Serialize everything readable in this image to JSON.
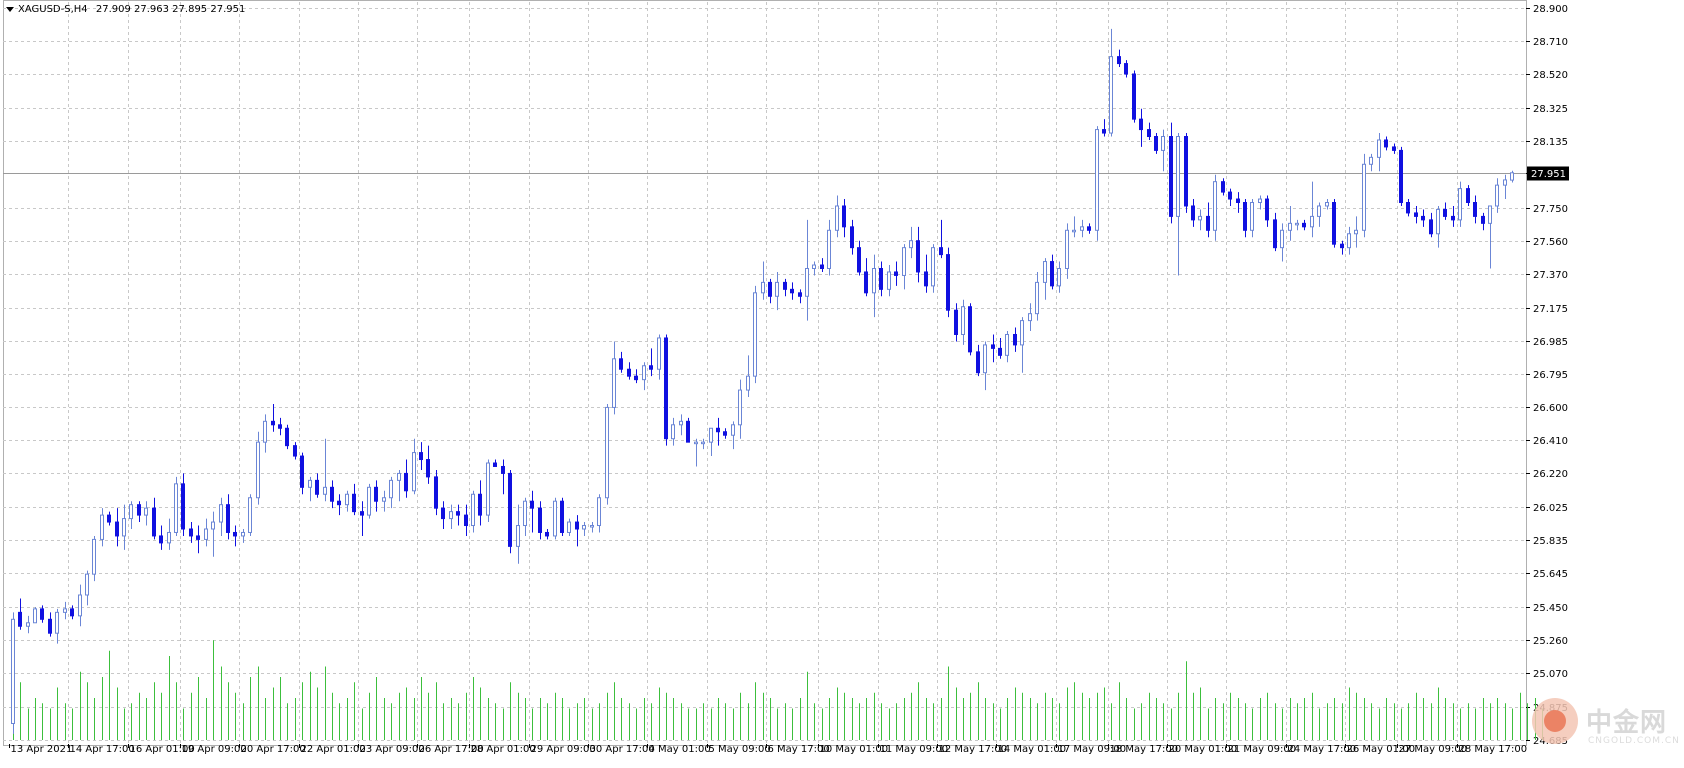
{
  "header": {
    "symbol": "XAGUSD-S,H4",
    "ohlc": "27.909 27.963 27.895 27.951"
  },
  "price_scale": [
    "28.900",
    "28.710",
    "28.520",
    "28.325",
    "28.135",
    "27.951",
    "27.750",
    "27.560",
    "27.370",
    "27.175",
    "26.985",
    "26.795",
    "26.600",
    "26.410",
    "26.220",
    "26.025",
    "25.835",
    "25.645",
    "25.450",
    "25.260",
    "25.070",
    "24.875",
    "24.685"
  ],
  "current_price": "27.951",
  "time_labels": [
    "13 Apr 2021",
    "14 Apr 17:00",
    "16 Apr 01:00",
    "19 Apr 09:00",
    "20 Apr 17:00",
    "22 Apr 01:00",
    "23 Apr 09:00",
    "26 Apr 17:00",
    "28 Apr 01:00",
    "29 Apr 09:00",
    "30 Apr 17:00",
    "4 May 01:00",
    "5 May 09:00",
    "6 May 17:00",
    "10 May 01:00",
    "11 May 09:00",
    "12 May 17:00",
    "14 May 01:00",
    "17 May 09:00",
    "18 May 17:00",
    "20 May 01:00",
    "21 May 09:00",
    "24 May 17:00",
    "26 May 01:00",
    "27 May 09:00",
    "28 May 17:00"
  ],
  "watermark": {
    "title": "中金网",
    "subtitle": "CNGOLD.COM.CN"
  },
  "colors": {
    "bull_body": "#ffffff",
    "bull_outline": "#6b86d6",
    "bear_body": "#1010e0",
    "volume": "#3cbf3c",
    "grid": "#c8c8c8",
    "current_line": "#9a9a9a",
    "price_tag_bg": "#000000",
    "price_tag_text": "#ffffff"
  },
  "chart_data": {
    "type": "candlestick",
    "symbol": "XAGUSD-S",
    "timeframe": "H4",
    "ylim": [
      24.685,
      28.9
    ],
    "grid": true,
    "current_price": 27.951,
    "ohlc": [
      [
        24.78,
        25.42,
        24.72,
        25.38
      ],
      [
        25.42,
        25.5,
        25.32,
        25.34
      ],
      [
        25.34,
        25.4,
        25.3,
        25.36
      ],
      [
        25.36,
        25.45,
        25.36,
        25.44
      ],
      [
        25.44,
        25.46,
        25.36,
        25.38
      ],
      [
        25.38,
        25.42,
        25.28,
        25.3
      ],
      [
        25.3,
        25.44,
        25.24,
        25.42
      ],
      [
        25.42,
        25.48,
        25.38,
        25.44
      ],
      [
        25.44,
        25.46,
        25.38,
        25.4
      ],
      [
        25.4,
        25.58,
        25.34,
        25.52
      ],
      [
        25.52,
        25.66,
        25.46,
        25.64
      ],
      [
        25.64,
        25.86,
        25.6,
        25.84
      ],
      [
        25.84,
        26.02,
        25.8,
        25.98
      ],
      [
        25.98,
        26.0,
        25.92,
        25.94
      ],
      [
        25.94,
        26.02,
        25.8,
        25.86
      ],
      [
        25.86,
        26.04,
        25.78,
        25.96
      ],
      [
        25.96,
        26.06,
        25.9,
        26.04
      ],
      [
        26.04,
        26.06,
        25.94,
        25.98
      ],
      [
        25.98,
        26.06,
        25.92,
        26.02
      ],
      [
        26.02,
        26.08,
        25.84,
        25.86
      ],
      [
        25.86,
        25.92,
        25.78,
        25.82
      ],
      [
        25.82,
        25.96,
        25.78,
        25.88
      ],
      [
        25.88,
        26.2,
        25.86,
        26.16
      ],
      [
        26.16,
        26.22,
        25.86,
        25.9
      ],
      [
        25.9,
        25.94,
        25.82,
        25.86
      ],
      [
        25.86,
        25.92,
        25.76,
        25.84
      ],
      [
        25.84,
        25.96,
        25.8,
        25.9
      ],
      [
        25.9,
        26.0,
        25.74,
        25.94
      ],
      [
        25.94,
        26.08,
        25.86,
        26.04
      ],
      [
        26.04,
        26.1,
        25.84,
        25.88
      ],
      [
        25.88,
        25.92,
        25.8,
        25.86
      ],
      [
        25.86,
        25.9,
        25.82,
        25.88
      ],
      [
        25.88,
        26.1,
        25.86,
        26.08
      ],
      [
        26.08,
        26.46,
        26.04,
        26.4
      ],
      [
        26.4,
        26.56,
        26.34,
        26.52
      ],
      [
        26.52,
        26.62,
        26.46,
        26.5
      ],
      [
        26.5,
        26.54,
        26.44,
        26.48
      ],
      [
        26.48,
        26.5,
        26.36,
        26.38
      ],
      [
        26.38,
        26.4,
        26.3,
        26.32
      ],
      [
        26.32,
        26.34,
        26.1,
        26.14
      ],
      [
        26.14,
        26.2,
        26.06,
        26.18
      ],
      [
        26.18,
        26.22,
        26.08,
        26.1
      ],
      [
        26.1,
        26.42,
        26.06,
        26.14
      ],
      [
        26.14,
        26.18,
        26.02,
        26.06
      ],
      [
        26.06,
        26.1,
        25.98,
        26.04
      ],
      [
        26.04,
        26.12,
        26.0,
        26.1
      ],
      [
        26.1,
        26.16,
        25.98,
        26.0
      ],
      [
        26.0,
        26.06,
        25.86,
        25.98
      ],
      [
        25.98,
        26.16,
        25.96,
        26.14
      ],
      [
        26.14,
        26.18,
        26.0,
        26.06
      ],
      [
        26.06,
        26.12,
        26.0,
        26.08
      ],
      [
        26.08,
        26.2,
        26.02,
        26.18
      ],
      [
        26.18,
        26.24,
        26.06,
        26.22
      ],
      [
        26.22,
        26.3,
        26.08,
        26.12
      ],
      [
        26.12,
        26.42,
        26.1,
        26.34
      ],
      [
        26.34,
        26.4,
        26.24,
        26.3
      ],
      [
        26.3,
        26.38,
        26.16,
        26.2
      ],
      [
        26.2,
        26.24,
        25.98,
        26.02
      ],
      [
        26.02,
        26.06,
        25.9,
        25.96
      ],
      [
        25.96,
        26.04,
        25.9,
        26.0
      ],
      [
        26.0,
        26.04,
        25.92,
        25.98
      ],
      [
        25.98,
        26.04,
        25.86,
        25.92
      ],
      [
        25.92,
        26.12,
        25.88,
        26.1
      ],
      [
        26.1,
        26.18,
        25.92,
        25.98
      ],
      [
        25.98,
        26.3,
        25.94,
        26.28
      ],
      [
        26.28,
        26.3,
        26.26,
        26.26
      ],
      [
        26.26,
        26.3,
        26.1,
        26.22
      ],
      [
        26.22,
        26.24,
        25.76,
        25.8
      ],
      [
        25.8,
        26.04,
        25.7,
        25.92
      ],
      [
        25.92,
        26.08,
        25.86,
        26.06
      ],
      [
        26.06,
        26.12,
        25.88,
        26.02
      ],
      [
        26.02,
        26.06,
        25.84,
        25.88
      ],
      [
        25.88,
        25.9,
        25.84,
        25.86
      ],
      [
        25.86,
        26.08,
        25.84,
        26.06
      ],
      [
        26.06,
        26.08,
        25.86,
        25.88
      ],
      [
        25.88,
        25.96,
        25.86,
        25.94
      ],
      [
        25.94,
        25.98,
        25.8,
        25.9
      ],
      [
        25.9,
        25.94,
        25.86,
        25.92
      ],
      [
        25.92,
        25.94,
        25.88,
        25.92
      ],
      [
        25.92,
        26.1,
        25.88,
        26.08
      ],
      [
        26.08,
        26.62,
        26.04,
        26.6
      ],
      [
        26.6,
        26.98,
        26.56,
        26.88
      ],
      [
        26.88,
        26.92,
        26.8,
        26.82
      ],
      [
        26.82,
        26.86,
        26.76,
        26.78
      ],
      [
        26.78,
        26.82,
        26.74,
        26.76
      ],
      [
        26.76,
        26.86,
        26.7,
        26.84
      ],
      [
        26.84,
        26.94,
        26.78,
        26.82
      ],
      [
        26.82,
        27.02,
        26.76,
        27.0
      ],
      [
        27.0,
        27.02,
        26.38,
        26.42
      ],
      [
        26.42,
        26.54,
        26.38,
        26.5
      ],
      [
        26.5,
        26.56,
        26.44,
        26.52
      ],
      [
        26.52,
        26.54,
        26.42,
        26.4
      ],
      [
        26.4,
        26.42,
        26.26,
        26.4
      ],
      [
        26.4,
        26.42,
        26.36,
        26.4
      ],
      [
        26.4,
        26.44,
        26.32,
        26.48
      ],
      [
        26.48,
        26.54,
        26.38,
        26.46
      ],
      [
        26.46,
        26.48,
        26.42,
        26.44
      ],
      [
        26.44,
        26.52,
        26.36,
        26.5
      ],
      [
        26.5,
        26.76,
        26.42,
        26.7
      ],
      [
        26.7,
        26.9,
        26.66,
        26.78
      ],
      [
        26.78,
        27.3,
        26.74,
        27.26
      ],
      [
        27.26,
        27.44,
        27.22,
        27.32
      ],
      [
        27.32,
        27.34,
        27.2,
        27.24
      ],
      [
        27.24,
        27.38,
        27.16,
        27.32
      ],
      [
        27.32,
        27.34,
        27.24,
        27.28
      ],
      [
        27.28,
        27.32,
        27.22,
        27.26
      ],
      [
        27.26,
        27.28,
        27.2,
        27.24
      ],
      [
        27.24,
        27.68,
        27.1,
        27.4
      ],
      [
        27.4,
        27.44,
        27.36,
        27.42
      ],
      [
        27.42,
        27.46,
        27.38,
        27.4
      ],
      [
        27.4,
        27.68,
        27.36,
        27.62
      ],
      [
        27.62,
        27.82,
        27.58,
        27.76
      ],
      [
        27.76,
        27.8,
        27.58,
        27.64
      ],
      [
        27.64,
        27.68,
        27.48,
        27.52
      ],
      [
        27.52,
        27.56,
        27.36,
        27.38
      ],
      [
        27.38,
        27.46,
        27.24,
        27.26
      ],
      [
        27.26,
        27.48,
        27.12,
        27.4
      ],
      [
        27.4,
        27.44,
        27.24,
        27.28
      ],
      [
        27.28,
        27.42,
        27.24,
        27.38
      ],
      [
        27.38,
        27.44,
        27.3,
        27.36
      ],
      [
        27.36,
        27.54,
        27.28,
        27.52
      ],
      [
        27.52,
        27.64,
        27.46,
        27.56
      ],
      [
        27.56,
        27.64,
        27.32,
        27.38
      ],
      [
        27.38,
        27.48,
        27.26,
        27.3
      ],
      [
        27.3,
        27.54,
        27.26,
        27.52
      ],
      [
        27.52,
        27.68,
        27.46,
        27.48
      ],
      [
        27.48,
        27.52,
        27.12,
        27.16
      ],
      [
        27.16,
        27.2,
        26.98,
        27.02
      ],
      [
        27.02,
        27.22,
        26.96,
        27.18
      ],
      [
        27.18,
        27.2,
        26.9,
        26.92
      ],
      [
        26.92,
        26.96,
        26.78,
        26.8
      ],
      [
        26.8,
        26.98,
        26.7,
        26.96
      ],
      [
        26.96,
        27.02,
        26.86,
        26.94
      ],
      [
        26.94,
        27.0,
        26.88,
        26.9
      ],
      [
        26.9,
        27.04,
        26.86,
        27.02
      ],
      [
        27.02,
        27.06,
        26.92,
        26.96
      ],
      [
        26.96,
        27.12,
        26.8,
        27.1
      ],
      [
        27.1,
        27.2,
        27.04,
        27.14
      ],
      [
        27.14,
        27.38,
        27.1,
        27.32
      ],
      [
        27.32,
        27.46,
        27.22,
        27.44
      ],
      [
        27.44,
        27.48,
        27.28,
        27.3
      ],
      [
        27.3,
        27.44,
        27.26,
        27.4
      ],
      [
        27.4,
        27.66,
        27.34,
        27.62
      ],
      [
        27.62,
        27.7,
        27.58,
        27.62
      ],
      [
        27.62,
        27.68,
        27.58,
        27.64
      ],
      [
        27.64,
        27.66,
        27.6,
        27.62
      ],
      [
        27.62,
        28.22,
        27.56,
        28.2
      ],
      [
        28.2,
        28.26,
        28.16,
        28.18
      ],
      [
        28.18,
        28.78,
        28.16,
        28.62
      ],
      [
        28.62,
        28.66,
        28.56,
        28.58
      ],
      [
        28.58,
        28.6,
        28.5,
        28.52
      ],
      [
        28.52,
        28.54,
        28.24,
        28.26
      ],
      [
        28.26,
        28.32,
        28.1,
        28.2
      ],
      [
        28.2,
        28.24,
        28.14,
        28.16
      ],
      [
        28.16,
        28.18,
        28.06,
        28.08
      ],
      [
        28.08,
        28.2,
        27.96,
        28.16
      ],
      [
        28.16,
        28.24,
        27.66,
        27.7
      ],
      [
        27.7,
        28.18,
        27.36,
        28.16
      ],
      [
        28.16,
        28.18,
        27.72,
        27.76
      ],
      [
        27.76,
        27.8,
        27.64,
        27.68
      ],
      [
        27.68,
        27.74,
        27.62,
        27.7
      ],
      [
        27.7,
        27.78,
        27.58,
        27.62
      ],
      [
        27.62,
        27.94,
        27.56,
        27.9
      ],
      [
        27.9,
        27.92,
        27.82,
        27.84
      ],
      [
        27.84,
        27.86,
        27.76,
        27.8
      ],
      [
        27.8,
        27.84,
        27.72,
        27.78
      ],
      [
        27.78,
        27.8,
        27.58,
        27.62
      ],
      [
        27.62,
        27.8,
        27.58,
        27.78
      ],
      [
        27.78,
        27.82,
        27.74,
        27.8
      ],
      [
        27.8,
        27.82,
        27.64,
        27.68
      ],
      [
        27.68,
        27.72,
        27.5,
        27.52
      ],
      [
        27.52,
        27.66,
        27.44,
        27.62
      ],
      [
        27.62,
        27.76,
        27.56,
        27.66
      ],
      [
        27.66,
        27.68,
        27.62,
        27.66
      ],
      [
        27.66,
        27.68,
        27.62,
        27.64
      ],
      [
        27.64,
        27.9,
        27.58,
        27.7
      ],
      [
        27.7,
        27.78,
        27.64,
        27.76
      ],
      [
        27.76,
        27.8,
        27.74,
        27.78
      ],
      [
        27.78,
        27.8,
        27.52,
        27.54
      ],
      [
        27.54,
        27.56,
        27.48,
        27.52
      ],
      [
        27.52,
        27.64,
        27.48,
        27.6
      ],
      [
        27.6,
        27.7,
        27.52,
        27.62
      ],
      [
        27.62,
        28.06,
        27.58,
        28.0
      ],
      [
        28.0,
        28.06,
        27.96,
        28.04
      ],
      [
        28.04,
        28.18,
        27.96,
        28.14
      ],
      [
        28.14,
        28.16,
        28.08,
        28.1
      ],
      [
        28.1,
        28.12,
        28.06,
        28.08
      ],
      [
        28.08,
        28.1,
        27.76,
        27.78
      ],
      [
        27.78,
        27.8,
        27.7,
        27.72
      ],
      [
        27.72,
        27.76,
        27.66,
        27.7
      ],
      [
        27.7,
        27.74,
        27.64,
        27.68
      ],
      [
        27.68,
        27.72,
        27.58,
        27.6
      ],
      [
        27.6,
        27.76,
        27.52,
        27.74
      ],
      [
        27.74,
        27.78,
        27.68,
        27.7
      ],
      [
        27.7,
        27.76,
        27.64,
        27.68
      ],
      [
        27.68,
        27.9,
        27.64,
        27.86
      ],
      [
        27.86,
        27.88,
        27.76,
        27.78
      ],
      [
        27.78,
        27.82,
        27.66,
        27.7
      ],
      [
        27.7,
        27.72,
        27.62,
        27.66
      ],
      [
        27.66,
        27.74,
        27.4,
        27.76
      ],
      [
        27.76,
        27.92,
        27.72,
        27.88
      ],
      [
        27.88,
        27.94,
        27.8,
        27.91
      ],
      [
        27.909,
        27.963,
        27.895,
        27.951
      ]
    ],
    "volume": [
      0.45,
      0.55,
      0.3,
      0.4,
      0.35,
      0.3,
      0.5,
      0.35,
      0.3,
      0.65,
      0.55,
      0.4,
      0.6,
      0.85,
      0.5,
      0.3,
      0.35,
      0.45,
      0.4,
      0.55,
      0.45,
      0.8,
      0.55,
      0.3,
      0.45,
      0.6,
      0.4,
      0.95,
      0.7,
      0.55,
      0.45,
      0.35,
      0.6,
      0.7,
      0.4,
      0.5,
      0.6,
      0.35,
      0.4,
      0.55,
      0.65,
      0.5,
      0.7,
      0.45,
      0.35,
      0.4,
      0.55,
      0.3,
      0.45,
      0.6,
      0.4,
      0.35,
      0.45,
      0.5,
      0.4,
      0.6,
      0.45,
      0.55,
      0.35,
      0.4,
      0.35,
      0.45,
      0.6,
      0.5,
      0.4,
      0.35,
      0.3,
      0.55,
      0.45,
      0.4,
      0.3,
      0.4,
      0.35,
      0.45,
      0.4,
      0.3,
      0.35,
      0.4,
      0.3,
      0.35,
      0.45,
      0.55,
      0.4,
      0.35,
      0.3,
      0.4,
      0.35,
      0.5,
      0.45,
      0.4,
      0.35,
      0.3,
      0.3,
      0.35,
      0.3,
      0.4,
      0.35,
      0.3,
      0.45,
      0.35,
      0.55,
      0.45,
      0.4,
      0.3,
      0.35,
      0.3,
      0.4,
      0.65,
      0.35,
      0.3,
      0.4,
      0.5,
      0.45,
      0.4,
      0.35,
      0.4,
      0.45,
      0.35,
      0.3,
      0.35,
      0.4,
      0.45,
      0.55,
      0.4,
      0.35,
      0.4,
      0.7,
      0.5,
      0.4,
      0.45,
      0.55,
      0.4,
      0.35,
      0.3,
      0.4,
      0.5,
      0.45,
      0.4,
      0.35,
      0.45,
      0.4,
      0.35,
      0.5,
      0.55,
      0.45,
      0.4,
      0.45,
      0.5,
      0.35,
      0.55,
      0.4,
      0.3,
      0.35,
      0.45,
      0.4,
      0.35,
      0.3,
      0.45,
      0.75,
      0.45,
      0.5,
      0.3,
      0.4,
      0.35,
      0.45,
      0.4,
      0.35,
      0.3,
      0.4,
      0.45,
      0.35,
      0.3,
      0.4,
      0.35,
      0.4,
      0.45,
      0.3,
      0.35,
      0.4,
      0.35,
      0.5,
      0.45,
      0.4,
      0.35,
      0.3,
      0.4,
      0.35,
      0.3,
      0.35,
      0.45,
      0.4,
      0.35,
      0.5,
      0.4,
      0.35,
      0.3,
      0.35,
      0.3,
      0.4,
      0.35,
      0.4,
      0.35,
      0.3,
      0.45,
      0.35,
      0.4,
      0.3
    ]
  }
}
